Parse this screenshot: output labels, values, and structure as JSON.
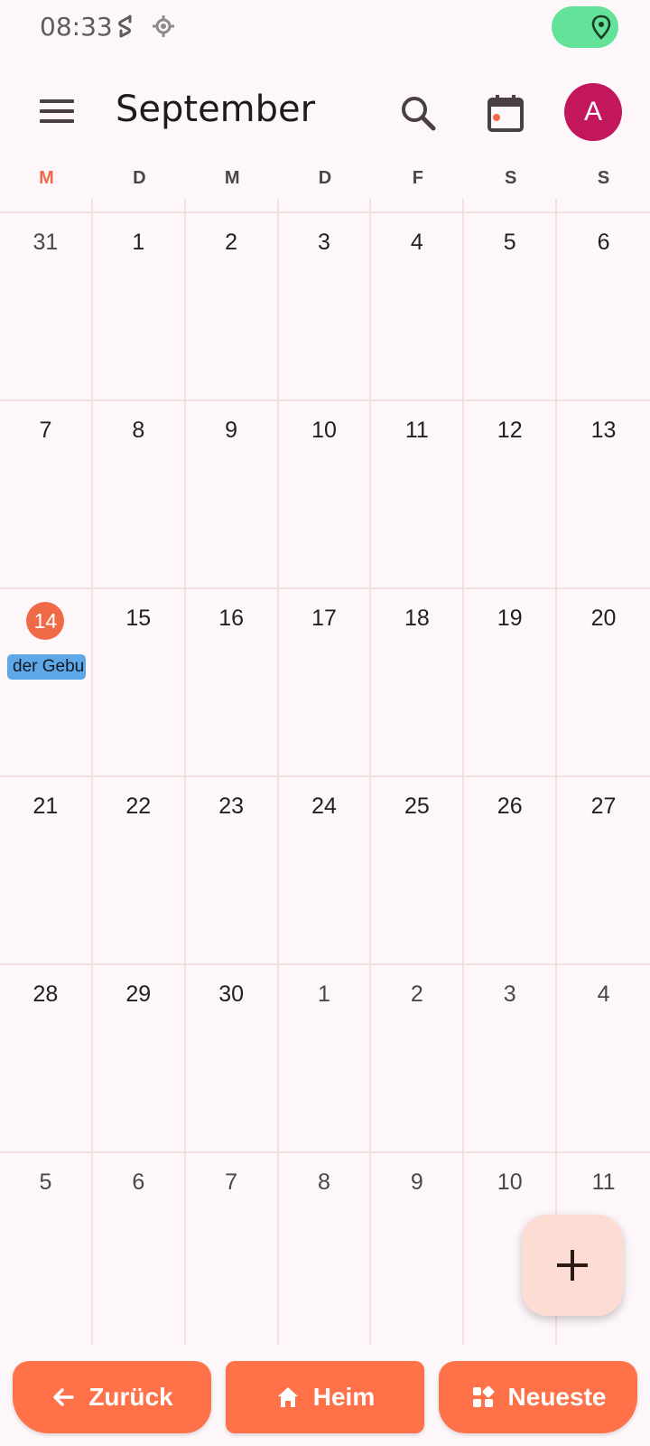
{
  "status_bar": {
    "time": "08:33",
    "icons": [
      "sync-icon",
      "gps-icon",
      "location-icon"
    ],
    "location_pill_color": "#63e39a"
  },
  "app_bar": {
    "title": "September",
    "avatar_letter": "A",
    "avatar_color": "#c2185b",
    "icons": [
      "menu-icon",
      "search-icon",
      "calendar-today-icon"
    ]
  },
  "weekdays": [
    "M",
    "D",
    "M",
    "D",
    "F",
    "S",
    "S"
  ],
  "accent_color": "#f06a47",
  "calendar": {
    "weeks": [
      [
        "31",
        "1",
        "2",
        "3",
        "4",
        "5",
        "6"
      ],
      [
        "7",
        "8",
        "9",
        "10",
        "11",
        "12",
        "13"
      ],
      [
        "14",
        "15",
        "16",
        "17",
        "18",
        "19",
        "20"
      ],
      [
        "21",
        "22",
        "23",
        "24",
        "25",
        "26",
        "27"
      ],
      [
        "28",
        "29",
        "30",
        "1",
        "2",
        "3",
        "4"
      ],
      [
        "5",
        "6",
        "7",
        "8",
        "9",
        "10",
        "11"
      ]
    ],
    "today": "14",
    "event": {
      "day": "14",
      "label": "der Gebu",
      "color": "#5fa8e8"
    }
  },
  "fab": {
    "icon": "plus-icon"
  },
  "bottom_nav": {
    "back_label": "Zurück",
    "home_label": "Heim",
    "recent_label": "Neueste",
    "color": "#ff7148"
  }
}
